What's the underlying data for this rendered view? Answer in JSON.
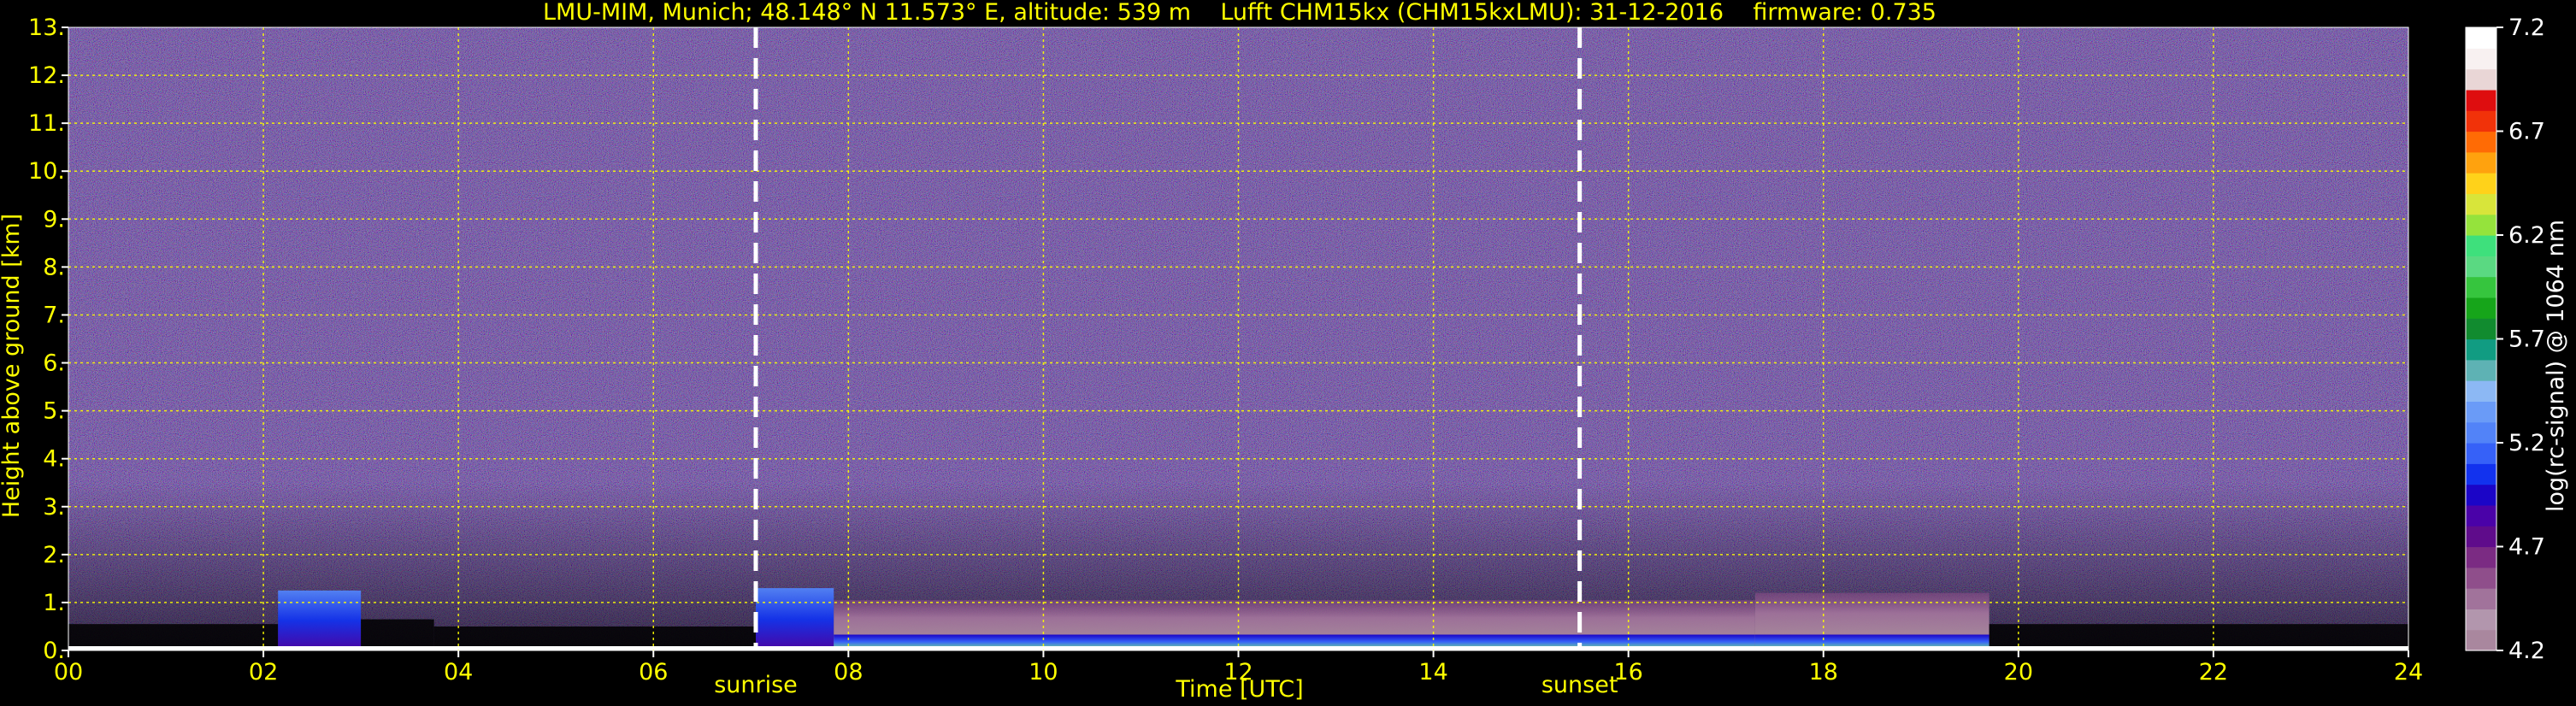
{
  "chart_data": {
    "type": "heatmap",
    "title": "LMU-MIM, Munich; 48.148° N 11.573° E, altitude: 539 m    Lufft CHM15kx (CHM15kxLMU): 31-12-2016    firmware: 0.735",
    "xlabel": "Time [UTC]",
    "ylabel": "Height above ground [km]",
    "xlim": [
      0,
      24
    ],
    "ylim": [
      0,
      13
    ],
    "x_ticks": [
      "00",
      "02",
      "04",
      "06",
      "08",
      "10",
      "12",
      "14",
      "16",
      "18",
      "20",
      "22",
      "24"
    ],
    "y_ticks": [
      "0.",
      "1.",
      "2.",
      "3.",
      "4.",
      "5.",
      "6.",
      "7.",
      "8.",
      "9.",
      "10.",
      "11.",
      "12.",
      "13."
    ],
    "grid": true,
    "annotations": [
      {
        "label": "sunrise",
        "x": 7.05
      },
      {
        "label": "sunset",
        "x": 15.5
      }
    ],
    "colorbar": {
      "label": "log(rc-signal) @ 1064 nm",
      "range": [
        4.2,
        7.2
      ],
      "ticks": [
        "4.2",
        "4.7",
        "5.2",
        "5.7",
        "6.2",
        "6.7",
        "7.2"
      ],
      "colors": [
        "#a9879e",
        "#b296ad",
        "#a1739b",
        "#8f4e8b",
        "#7b2b83",
        "#5f0c8b",
        "#4a02a8",
        "#1b05c7",
        "#1232ee",
        "#3661f8",
        "#5283f8",
        "#6a9bf7",
        "#8cb8f4",
        "#5eb2b4",
        "#119c82",
        "#118b2f",
        "#16a51a",
        "#36c53e",
        "#5ad982",
        "#3ee07c",
        "#95e33c",
        "#d8e53a",
        "#ffd21a",
        "#ffa20e",
        "#ff6b05",
        "#f13209",
        "#de0d0f",
        "#e9d6d6",
        "#f8f1f1",
        "#ffffff"
      ]
    },
    "background_signal": 4.8,
    "boundary_layer": [
      {
        "t0": 0.0,
        "t1": 2.15,
        "top": 0.55,
        "class": "low"
      },
      {
        "t0": 2.15,
        "t1": 3.0,
        "top": 1.25,
        "class": "elevated"
      },
      {
        "t0": 3.0,
        "t1": 3.75,
        "top": 0.65,
        "class": "low"
      },
      {
        "t0": 3.75,
        "t1": 7.05,
        "top": 0.5,
        "class": "low"
      },
      {
        "t0": 7.05,
        "t1": 7.85,
        "top": 1.3,
        "class": "elevated"
      },
      {
        "t0": 7.85,
        "t1": 17.3,
        "top": 1.05,
        "class": "layer"
      },
      {
        "t0": 17.3,
        "t1": 19.7,
        "top": 1.2,
        "class": "layer"
      },
      {
        "t0": 19.7,
        "t1": 24.0,
        "top": 0.55,
        "class": "low"
      }
    ]
  },
  "colors": {
    "axis_text": "#ffff00",
    "grid": "#ffff00",
    "background": "#000000",
    "noise_base": "#3c2a6e",
    "marker": "#ffffff"
  }
}
